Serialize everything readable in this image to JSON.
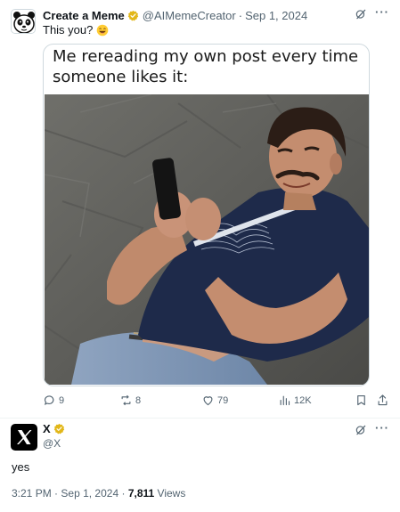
{
  "quoted_post": {
    "author_name": "Create a Meme",
    "author_handle": "@AIMemeCreator",
    "separator": "·",
    "date": "Sep 1, 2024",
    "text": "This you?",
    "meme_caption": "Me rereading my own post every time someone likes it:",
    "stats": {
      "replies": "9",
      "reposts": "8",
      "likes": "79",
      "views": "12K"
    }
  },
  "main_post": {
    "author_name": "X",
    "author_handle": "@X",
    "text": "yes",
    "time": "3:21 PM",
    "separator": "·",
    "date": "Sep 1, 2024",
    "separator2": "·",
    "views_count": "7,811",
    "views_label": "Views"
  },
  "colors": {
    "verified_gold": "#e2b719",
    "muted_text": "#536471",
    "text": "#0f1419"
  },
  "icons": [
    "grok-icon",
    "more-icon",
    "reply-icon",
    "repost-icon",
    "like-icon",
    "views-icon",
    "bookmark-icon",
    "share-icon",
    "x-logo-icon",
    "panda-avatar-icon",
    "verified-icon",
    "laughing-emoji-icon"
  ]
}
